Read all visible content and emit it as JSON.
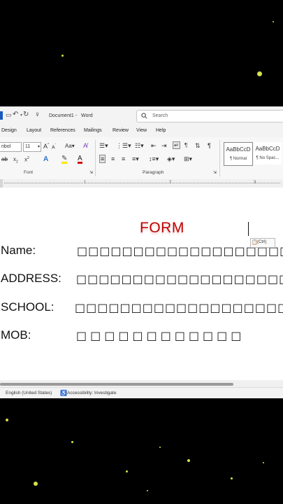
{
  "titlebar": {
    "document_name": "Document1",
    "app_name": "Word",
    "separator": "-",
    "search_placeholder": "Search"
  },
  "menu": [
    "Design",
    "Layout",
    "References",
    "Mailings",
    "Review",
    "View",
    "Help"
  ],
  "ribbon": {
    "font_name": "nbol",
    "font_size": "11",
    "font_group_label": "Font",
    "paragraph_group_label": "Paragraph",
    "styles": [
      {
        "preview": "AaBbCcD",
        "name": "¶ Normal"
      },
      {
        "preview": "AaBbCcD",
        "name": "¶ No Spac..."
      }
    ]
  },
  "ruler": {
    "ticks": [
      "1",
      "2",
      "3"
    ]
  },
  "form": {
    "title": "FORM",
    "fields": [
      {
        "label": "Name:",
        "boxes": "□□□□□□□□□□□□□□□□□□□□□"
      },
      {
        "label": "ADDRESS:",
        "boxes": "□□□□□□□□□□□□□□□□□□□"
      },
      {
        "label": "SCHOOL:",
        "boxes": "□□□□□□□□□□□□□□□□□□□□"
      },
      {
        "label": "MOB:",
        "boxes": "□□□□□□□□□□□□"
      }
    ]
  },
  "paste_options": {
    "label": "(Ctrl)"
  },
  "statusbar": {
    "language": "English (United States)",
    "accessibility": "Accessibility: Investigate"
  },
  "colors": {
    "form_title": "#c00000",
    "stars": "#d8e04a",
    "background": "#000000"
  }
}
